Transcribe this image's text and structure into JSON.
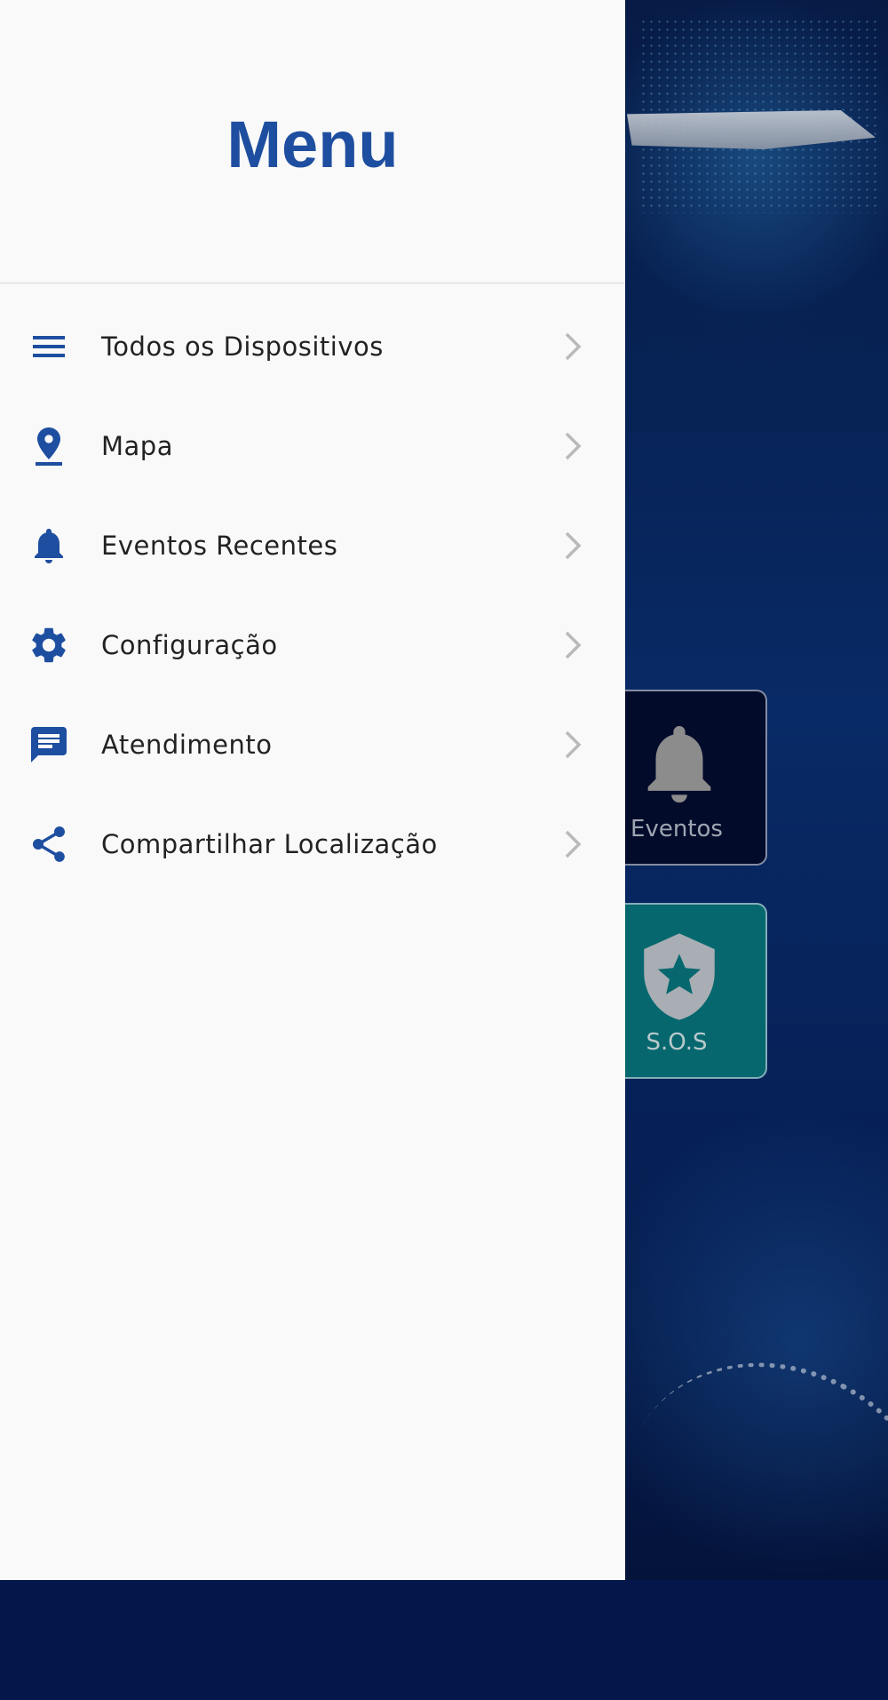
{
  "colors": {
    "accent": "#1e4ea0",
    "drawer_background": "#f9f9f9",
    "chevron": "#b9b9b9",
    "background_screen": "#061f54",
    "sos_card": "#06686e"
  },
  "drawer": {
    "title": "Menu",
    "items": [
      {
        "label": "Todos os Dispositivos",
        "icon": "list-icon"
      },
      {
        "label": "Mapa",
        "icon": "map-pin-icon"
      },
      {
        "label": "Eventos Recentes",
        "icon": "bell-icon"
      },
      {
        "label": "Configuração",
        "icon": "gear-icon"
      },
      {
        "label": "Atendimento",
        "icon": "chat-icon"
      },
      {
        "label": "Compartilhar Localização",
        "icon": "share-icon"
      }
    ]
  },
  "background_screen": {
    "cards": [
      {
        "label": "Eventos",
        "icon": "bell-icon"
      },
      {
        "label": "S.O.S",
        "icon": "shield-star-icon"
      }
    ]
  }
}
